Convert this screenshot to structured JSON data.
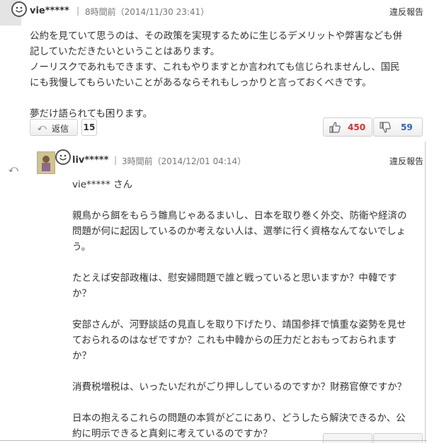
{
  "top_comment": {
    "username": "vie*****",
    "separator": "|",
    "time_ago": "8時間前（2014/11/30 23:41）",
    "report_label": "違反報告",
    "body_lines": [
      "公約を見ていて思うのは、その政策を実現するために生じるデメリットや弊害なども併",
      "記していただきたいということはあります。",
      "ノーリスクであれもできます、これもやりますとか言われても信じられませんし、国民",
      "にも我慢してもらいたいことがあるならそれもしっかりと言っておくべきです。",
      "",
      "夢だけ語られても困ります。"
    ],
    "reply_button_label": "返信",
    "reply_count": "15",
    "likes": "450",
    "dislikes": "59"
  },
  "reply_comment": {
    "username": "liv*****",
    "separator": "|",
    "time_ago": "3時間前（2014/12/01 04:14）",
    "report_label": "違反報告",
    "body_lines": [
      "vie***** さん",
      "",
      "親鳥から餌をもらう雛鳥じゃあるまいし、日本を取り巻く外交、防衛や経済の",
      "問題が何に起因しているのか考えない人は、選挙に行く資格なんてないでしょ",
      "う。",
      "",
      "たとえば安部政権は、慰安婦問題で誰と戦っていると思いますか？中韓です",
      "か？",
      "",
      "安部さんが、河野談話の見直しを取り下げたり、靖国参拝で慎重な姿勢を見せ",
      "ておられるのはなぜですか？これも中韓からの圧力だとおもっておられます",
      "か？",
      "",
      "消費税増税は、いったいだれがごり押ししているのですか？財務官僚ですか？",
      "",
      "日本の抱えるこれらの問題の本質がどこにあり、どうしたら解決できるか、公",
      "約に明示できると真剣に考えているのですか？"
    ]
  },
  "icons": {
    "reply_arrow": "reply-arrow-icon",
    "thumbs_up": "thumbs-up-icon",
    "thumbs_down": "thumbs-down-icon",
    "smiley": "smiley-icon"
  },
  "colors": {
    "like": "#cc3333",
    "dislike": "#3366aa"
  }
}
